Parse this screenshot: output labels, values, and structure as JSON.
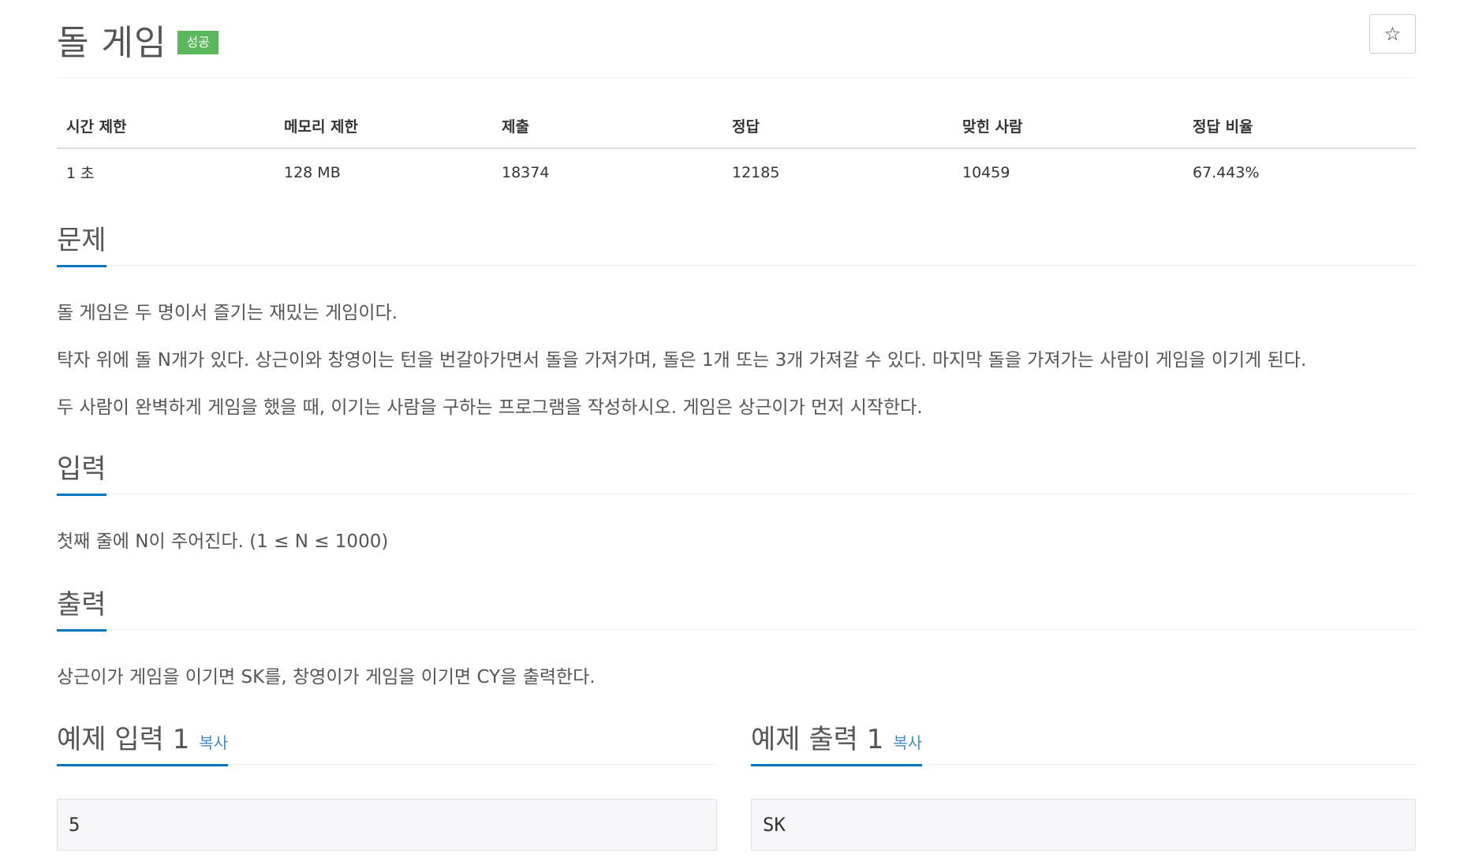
{
  "header": {
    "title": "돌 게임",
    "status_badge": "성공",
    "star_icon": "☆"
  },
  "info_table": {
    "headers": [
      "시간 제한",
      "메모리 제한",
      "제출",
      "정답",
      "맞힌 사람",
      "정답 비율"
    ],
    "values": [
      "1 초",
      "128 MB",
      "18374",
      "12185",
      "10459",
      "67.443%"
    ]
  },
  "problem": {
    "heading": "문제",
    "paragraphs": [
      "돌 게임은 두 명이서 즐기는 재밌는 게임이다.",
      "탁자 위에 돌 N개가 있다. 상근이와 창영이는 턴을 번갈아가면서 돌을 가져가며, 돌은 1개 또는 3개 가져갈 수 있다. 마지막 돌을 가져가는 사람이 게임을 이기게 된다.",
      "두 사람이 완벽하게 게임을 했을 때, 이기는 사람을 구하는 프로그램을 작성하시오. 게임은 상근이가 먼저 시작한다."
    ]
  },
  "input": {
    "heading": "입력",
    "text": "첫째 줄에 N이 주어진다. (1 ≤ N ≤ 1000)"
  },
  "output": {
    "heading": "출력",
    "text": "상근이가 게임을 이기면 SK를, 창영이가 게임을 이기면 CY을 출력한다."
  },
  "sample_input": {
    "heading": "예제 입력 1",
    "copy_label": "복사",
    "value": "5"
  },
  "sample_output": {
    "heading": "예제 출력 1",
    "copy_label": "복사",
    "value": "SK"
  },
  "colors": {
    "accent": "#0076c0",
    "badge": "#5cb85c",
    "link": "#428bca"
  }
}
